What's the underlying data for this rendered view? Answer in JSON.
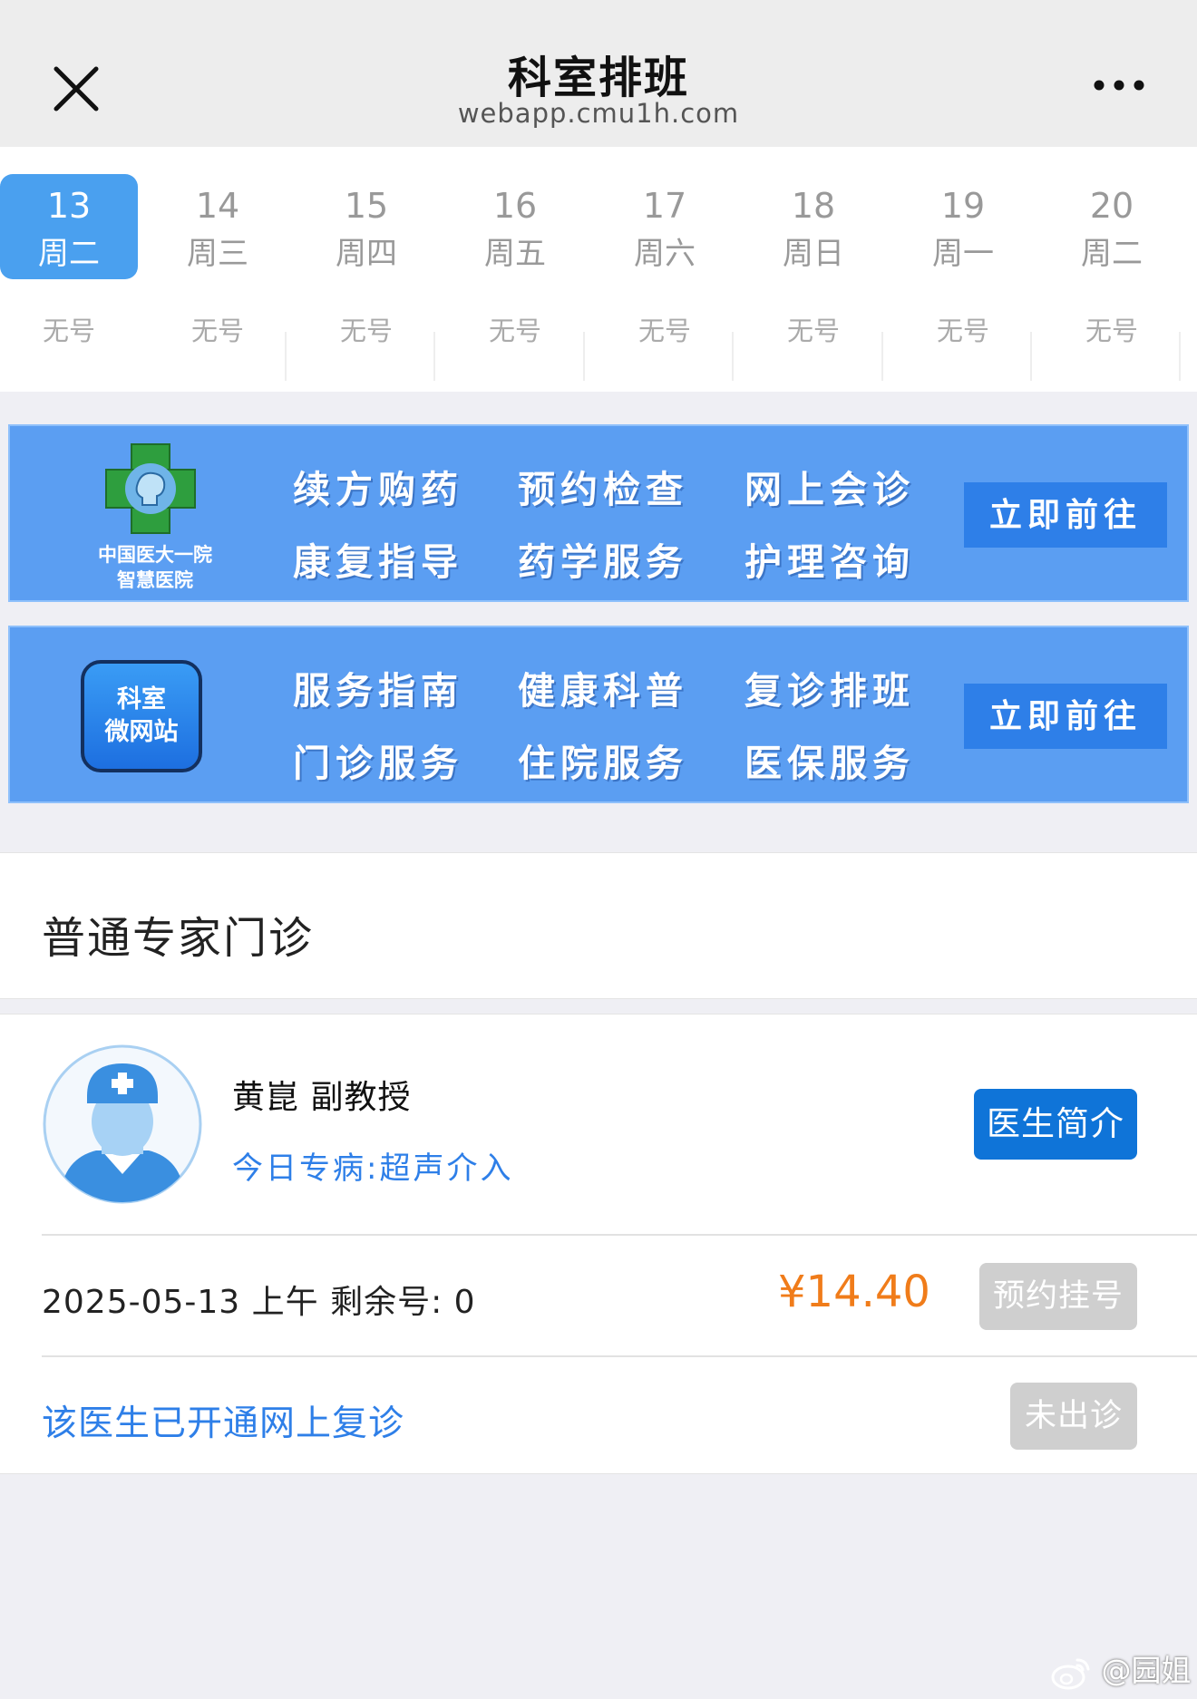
{
  "nav": {
    "title": "科室排班",
    "url": "webapp.cmu1h.com",
    "close_icon": "close-icon",
    "more_icon": "more-icon"
  },
  "dates": [
    {
      "day": "13",
      "weekday": "周二",
      "status": "无号",
      "active": true
    },
    {
      "day": "14",
      "weekday": "周三",
      "status": "无号",
      "active": false
    },
    {
      "day": "15",
      "weekday": "周四",
      "status": "无号",
      "active": false
    },
    {
      "day": "16",
      "weekday": "周五",
      "status": "无号",
      "active": false
    },
    {
      "day": "17",
      "weekday": "周六",
      "status": "无号",
      "active": false
    },
    {
      "day": "18",
      "weekday": "周日",
      "status": "无号",
      "active": false
    },
    {
      "day": "19",
      "weekday": "周一",
      "status": "无号",
      "active": false
    },
    {
      "day": "20",
      "weekday": "周二",
      "status": "无号",
      "active": false
    }
  ],
  "banner1": {
    "logo_caption_line1": "中国医大一院",
    "logo_caption_line2": "智慧医院",
    "items": [
      "续方购药",
      "预约检查",
      "网上会诊",
      "康复指导",
      "药学服务",
      "护理咨询"
    ],
    "go_label": "立即前往"
  },
  "banner2": {
    "logo_line1": "科室",
    "logo_line2": "微网站",
    "items": [
      "服务指南",
      "健康科普",
      "复诊排班",
      "门诊服务",
      "住院服务",
      "医保服务"
    ],
    "go_label": "立即前往"
  },
  "clinic": {
    "title": "普通专家门诊"
  },
  "doctor": {
    "name": "黄崑 副教授",
    "special": "今日专病:超声介入",
    "profile_button": "医生简介",
    "slot_info": "2025-05-13 上午 剩余号: 0",
    "price": "¥14.40",
    "book_button": "预约挂号",
    "revisit_text": "该医生已开通网上复诊",
    "status_button": "未出诊"
  },
  "colors": {
    "accent": "#4aa0ef",
    "primary_button": "#0f74d8",
    "link": "#2e7fe8",
    "price": "#f07c1a",
    "disabled": "#cfcfcf",
    "banner_bg": "#5b9ef2"
  },
  "watermark": {
    "text": "@园姐",
    "icon": "weibo-icon"
  }
}
